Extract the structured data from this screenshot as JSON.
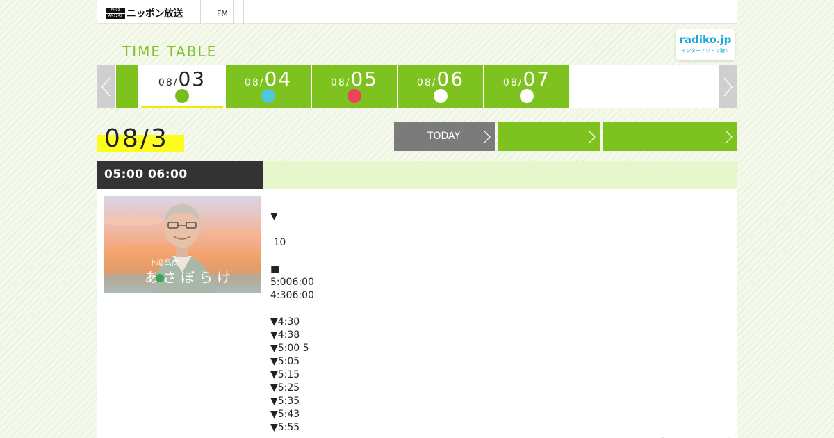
{
  "header": {
    "logo_badge_top": "FM93",
    "logo_badge_bottom": "AM1242",
    "logo_text": "ニッポン放送",
    "fm_label": "FM"
  },
  "timetable": {
    "title": "TIME TABLE",
    "radiko_logo": "radiko.jp",
    "radiko_sub": "インターネットで聴く"
  },
  "date_tabs": [
    {
      "month": "08/",
      "day": "03",
      "dot_color": "#76bd1d",
      "active": true
    },
    {
      "month": "08/",
      "day": "04",
      "dot_color": "#4cc7dd",
      "active": false
    },
    {
      "month": "08/",
      "day": "05",
      "dot_color": "#e8455a",
      "active": false
    },
    {
      "month": "08/",
      "day": "06",
      "dot_color": "#ffffff",
      "active": false
    },
    {
      "month": "08/",
      "day": "07",
      "dot_color": "#ffffff",
      "active": false
    }
  ],
  "current_date": "08/3",
  "buttons": {
    "today_label": "TODAY",
    "green1_label": "",
    "green2_label": ""
  },
  "program": {
    "time_range": "05:00  06:00",
    "thumbnail_name": "上柳昌彦",
    "thumbnail_title": "あさぼらけ",
    "lines": [
      "▼",
      "",
      " 10",
      "",
      "■",
      "5:006:00",
      "4:306:00",
      "",
      "▼4:30",
      "▼4:38",
      "▼5:00 5",
      "▼5:05",
      "▼5:15",
      "▼5:25",
      "▼5:35",
      "▼5:43",
      "▼5:55"
    ]
  },
  "colors": {
    "accent_green": "#7dc21e",
    "highlight_yellow": "#fcfc1e",
    "header_dark": "#333333",
    "header_light": "#e5f7cb",
    "radiko_blue": "#1aa6d9"
  }
}
